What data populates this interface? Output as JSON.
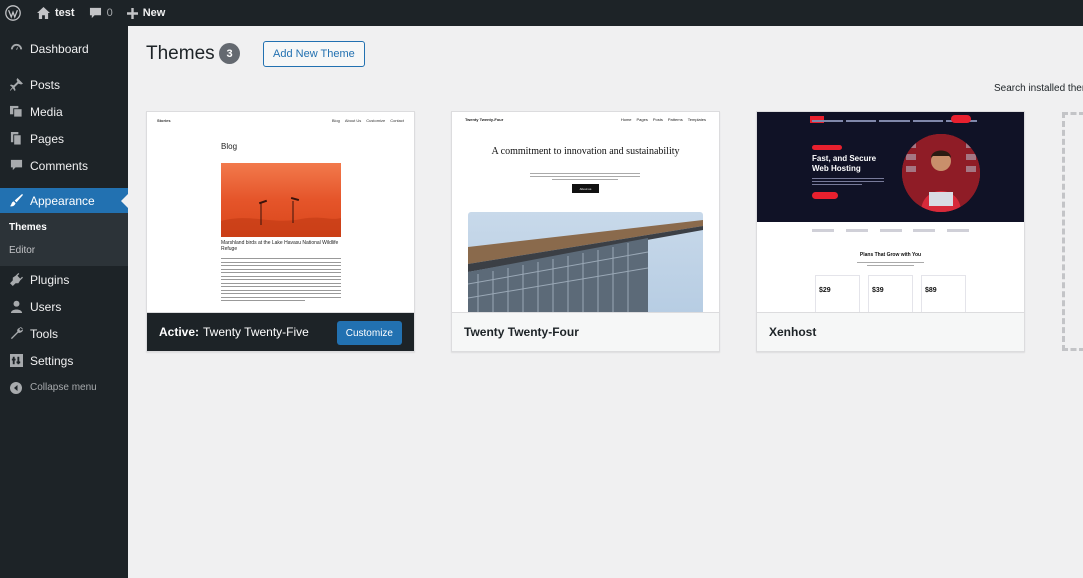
{
  "admin_bar": {
    "site_name": "test",
    "comments_count": "0",
    "new_label": "New"
  },
  "sidebar": {
    "items": [
      {
        "label": "Dashboard",
        "icon": "dashboard-icon"
      },
      {
        "label": "Posts",
        "icon": "pin-icon"
      },
      {
        "label": "Media",
        "icon": "media-icon"
      },
      {
        "label": "Pages",
        "icon": "pages-icon"
      },
      {
        "label": "Comments",
        "icon": "comment-icon"
      },
      {
        "label": "Appearance",
        "icon": "brush-icon",
        "active": true
      },
      {
        "label": "Plugins",
        "icon": "plugin-icon"
      },
      {
        "label": "Users",
        "icon": "users-icon"
      },
      {
        "label": "Tools",
        "icon": "wrench-icon"
      },
      {
        "label": "Settings",
        "icon": "settings-icon"
      }
    ],
    "submenu": [
      {
        "label": "Themes",
        "current": true
      },
      {
        "label": "Editor"
      }
    ],
    "collapse_label": "Collapse menu"
  },
  "main": {
    "title": "Themes",
    "count": "3",
    "add_new_label": "Add New Theme",
    "search_label": "Search installed themes..."
  },
  "themes": [
    {
      "name": "Twenty Twenty-Five",
      "active_prefix": "Active:",
      "customize_label": "Customize",
      "active": true,
      "preview": {
        "site_title": "Stories",
        "nav": [
          "Blog",
          "About Us",
          "Customize",
          "Contact"
        ],
        "heading": "Blog",
        "caption": "Marshland birds at the Lake Havasu National Wildlife Refuge"
      }
    },
    {
      "name": "Twenty Twenty-Four",
      "preview": {
        "site_title": "Twenty Twenty-Four",
        "nav": [
          "Home",
          "Pages",
          "Posts",
          "Patterns",
          "Templates"
        ],
        "headline": "A commitment to innovation and sustainability",
        "button": "About us"
      }
    },
    {
      "name": "Xenhost",
      "preview": {
        "hero": "Fast, and Secure Web Hosting",
        "plans_heading": "Plans That Grow with You",
        "prices": [
          "$29",
          "$39",
          "$89"
        ]
      }
    }
  ],
  "colors": {
    "accent": "#2271b1",
    "admin_dark": "#1d2327",
    "xenhost_red": "#e8202e"
  }
}
